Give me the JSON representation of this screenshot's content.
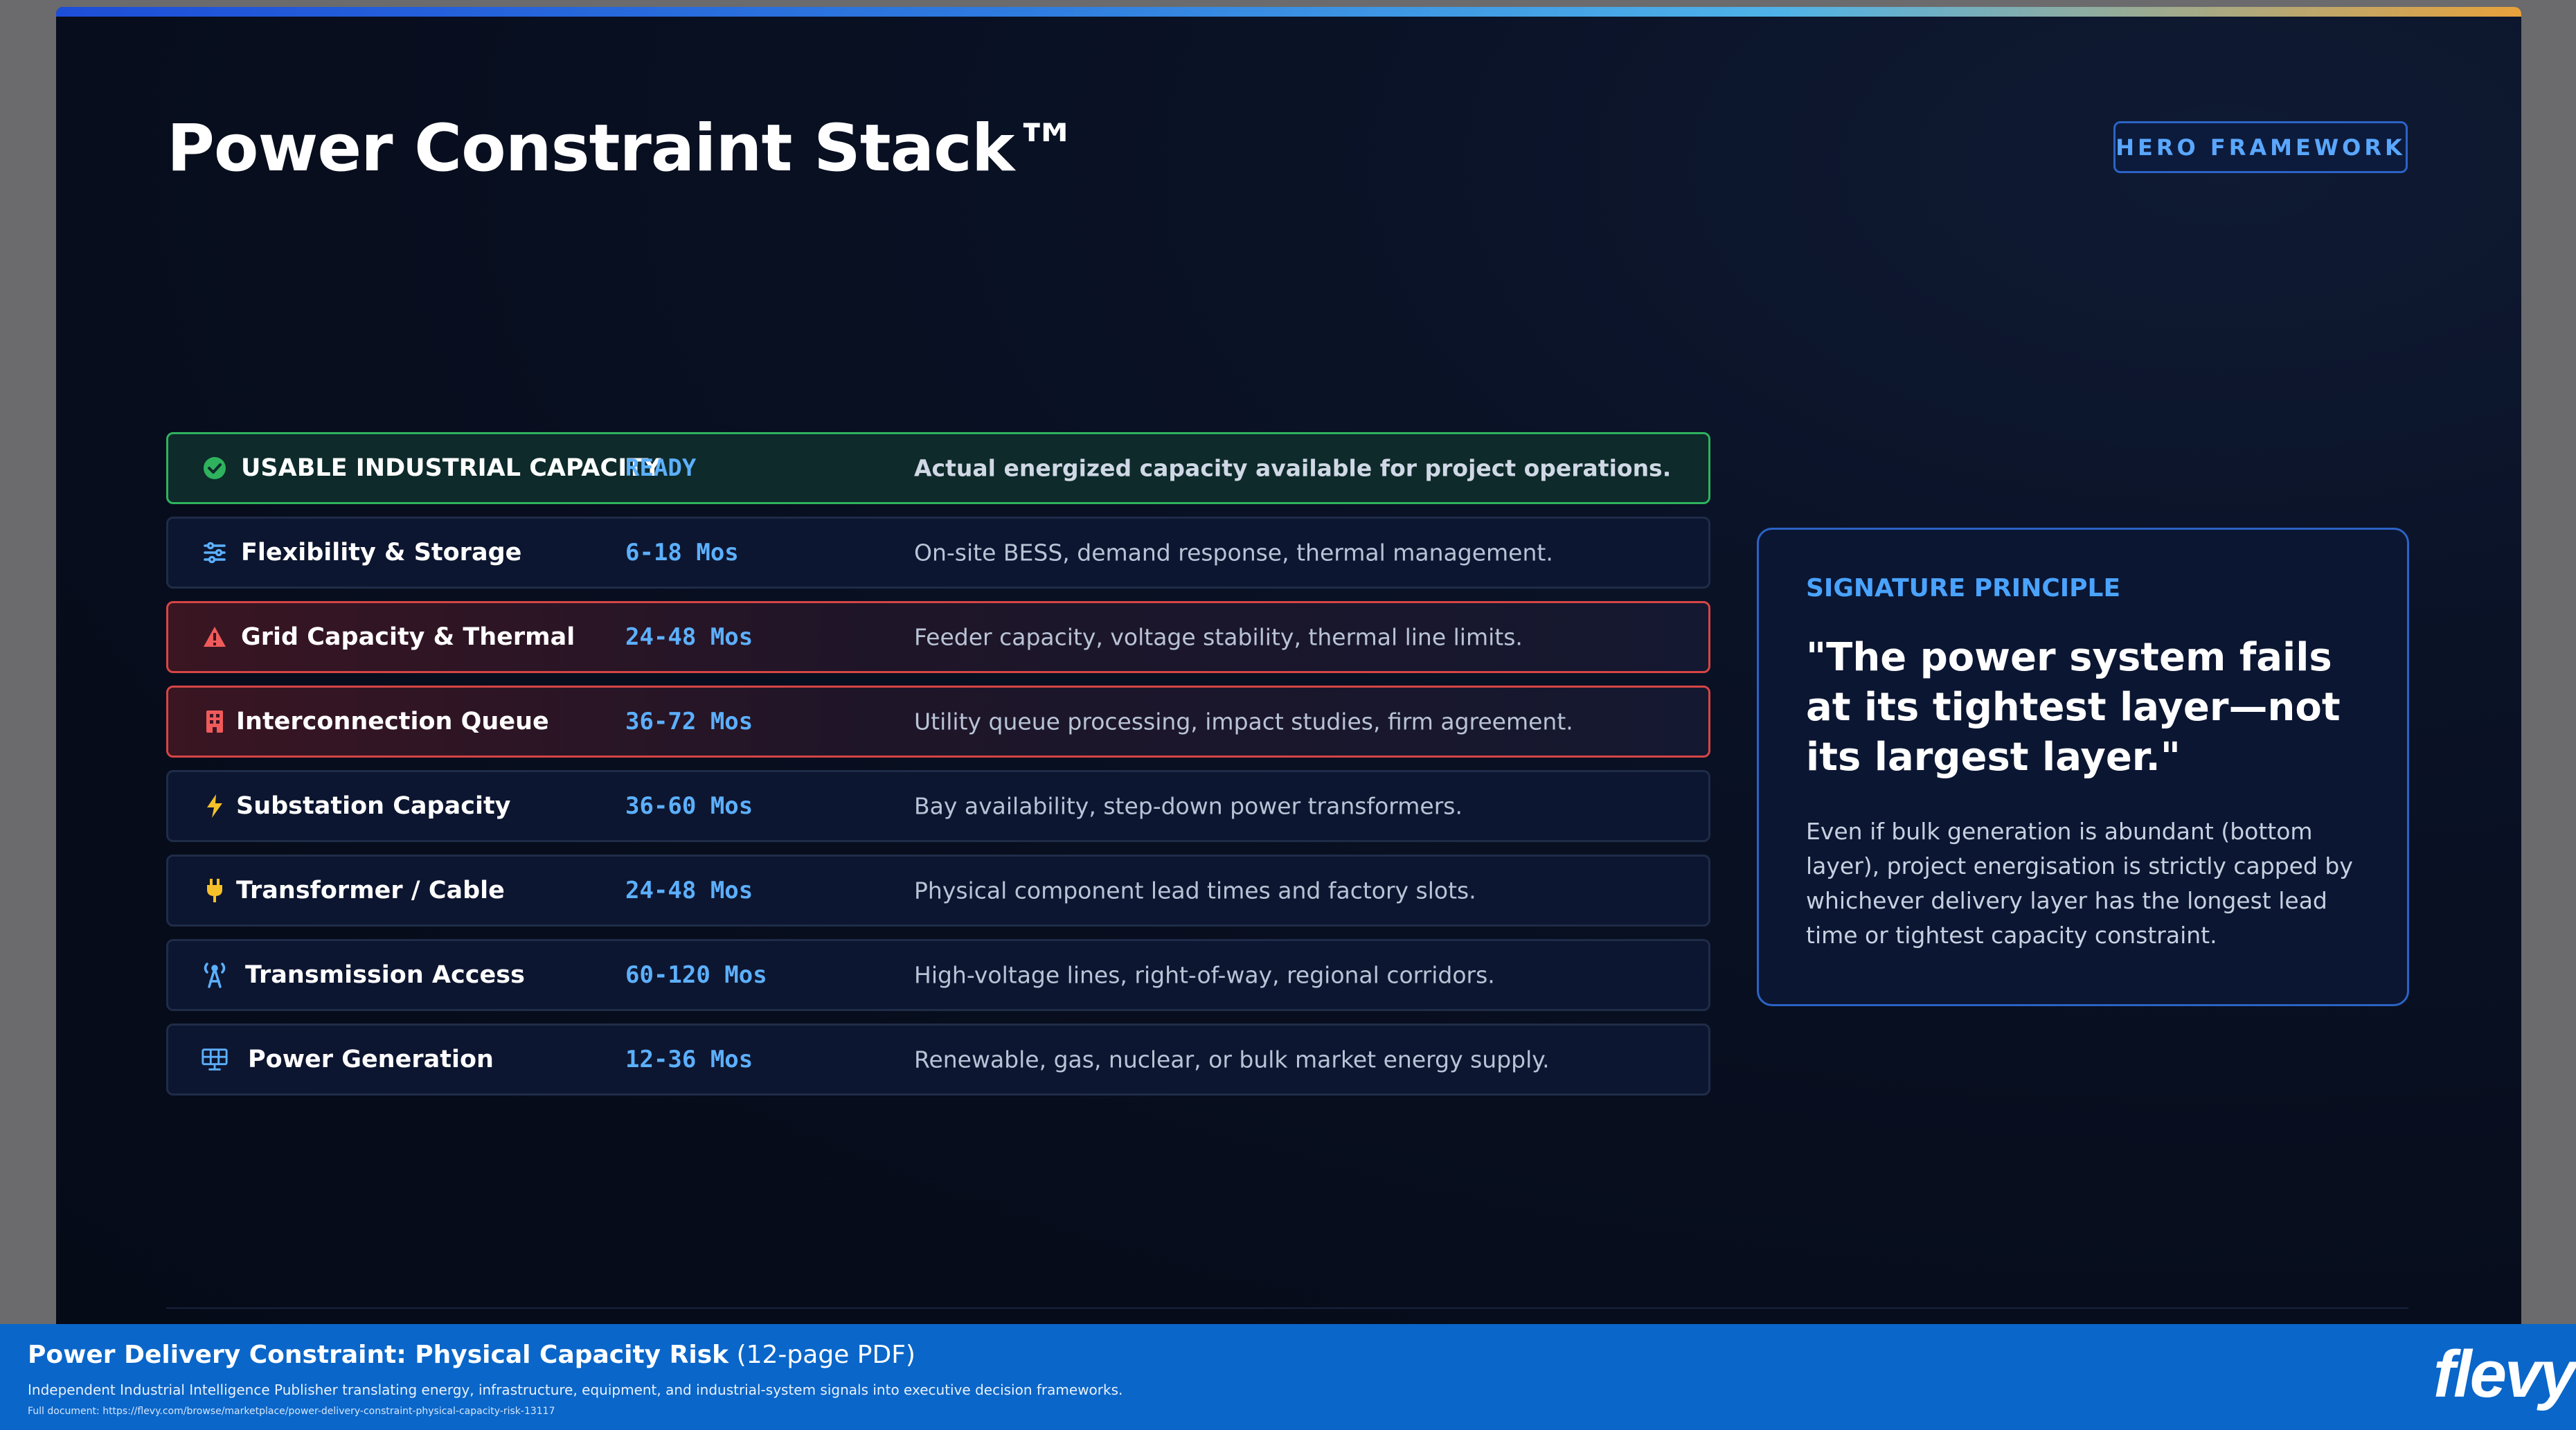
{
  "slide": {
    "title": "Power Constraint Stack™",
    "badge": "HERO FRAMEWORK"
  },
  "layers": [
    {
      "name": "USABLE INDUSTRIAL CAPACITY",
      "time": "READY",
      "desc": "Actual energized capacity available for project operations.",
      "icon": "check-circle-icon",
      "status": "ready"
    },
    {
      "name": "Flexibility & Storage",
      "time": "6-18 Mos",
      "desc": "On-site BESS, demand response, thermal management.",
      "icon": "sliders-icon",
      "status": "normal"
    },
    {
      "name": "Grid Capacity & Thermal",
      "time": "24-48 Mos",
      "desc": "Feeder capacity, voltage stability, thermal line limits.",
      "icon": "warning-triangle-icon",
      "status": "critical"
    },
    {
      "name": "Interconnection Queue",
      "time": "36-72 Mos",
      "desc": "Utility queue processing, impact studies, firm agreement.",
      "icon": "building-icon",
      "status": "critical"
    },
    {
      "name": "Substation Capacity",
      "time": "36-60 Mos",
      "desc": "Bay availability, step-down power transformers.",
      "icon": "lightning-icon",
      "status": "normal"
    },
    {
      "name": "Transformer / Cable",
      "time": "24-48 Mos",
      "desc": "Physical component lead times and factory slots.",
      "icon": "plug-icon",
      "status": "normal"
    },
    {
      "name": "Transmission Access",
      "time": "60-120 Mos",
      "desc": "High-voltage lines, right-of-way, regional corridors.",
      "icon": "tower-icon",
      "status": "normal"
    },
    {
      "name": "Power Generation",
      "time": "12-36 Mos",
      "desc": "Renewable, gas, nuclear, or bulk market energy supply.",
      "icon": "solar-panel-icon",
      "status": "normal"
    }
  ],
  "principle": {
    "label": "SIGNATURE PRINCIPLE",
    "quote": "\"The power system fails at its tightest layer—not its largest layer.\"",
    "body": "Even if bulk generation is abundant (bottom layer), project energisation is strictly capped by whichever delivery layer has the longest lead time or tightest capacity constraint."
  },
  "footer": {
    "title_bold": "Power Delivery Constraint: Physical Capacity Risk",
    "title_suffix": " (12-page PDF)",
    "subtitle": "Independent Industrial Intelligence Publisher translating energy, infrastructure, equipment, and industrial-system signals into executive decision frameworks.",
    "link": "Full document: https://flevy.com/browse/marketplace/power-delivery-constraint-physical-capacity-risk-13117",
    "logo": "flevy"
  },
  "colors": {
    "accent": "#5cb0ff",
    "ready": "#2fb25e",
    "critical": "#d64545",
    "footer": "#0a66c9"
  }
}
